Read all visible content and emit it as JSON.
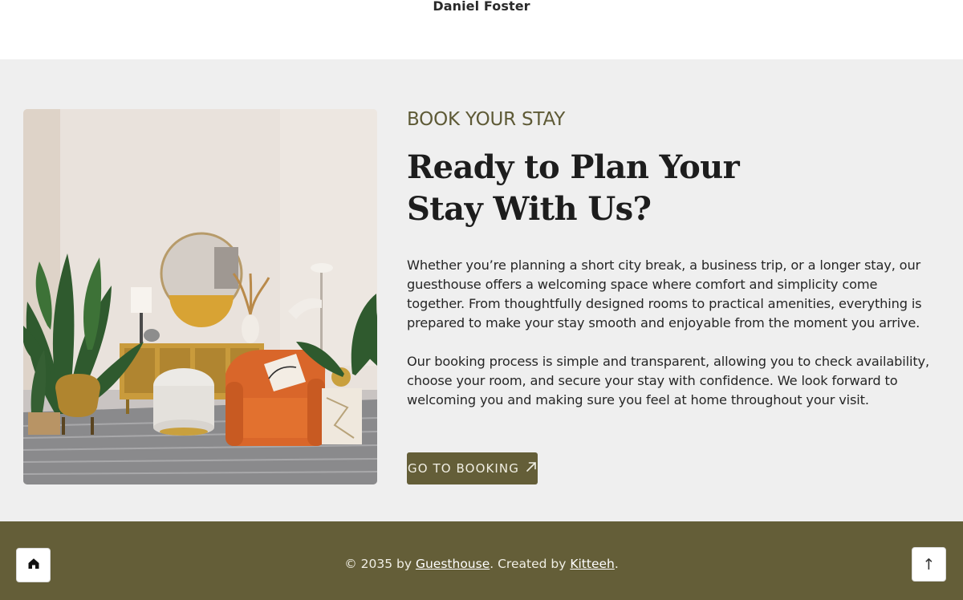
{
  "testimonial": {
    "author": "Daniel Foster"
  },
  "booking": {
    "eyebrow": "BOOK YOUR STAY",
    "heading_line1": "Ready to Plan Your",
    "heading_line2": "Stay With Us?",
    "paragraph1": "Whether you’re planning a short city break, a business trip, or a longer stay, our guesthouse offers a welcoming space where comfort and simplicity come together. From thoughtfully designed rooms to practical amenities, everything is prepared to make your stay smooth and enjoyable from the moment you arrive.",
    "paragraph2": "Our booking process is simple and transparent, allowing you to check availability, choose your room, and secure your stay with confidence. We look forward to welcoming you and making sure you feel at home throughout your visit.",
    "button_label": "GO TO BOOKING",
    "button_icon": "arrow-up-right-icon"
  },
  "footer": {
    "copyright_prefix": "© 2035 by ",
    "brand_link": "Guesthouse",
    "middle_text": ". Created by ",
    "creator_link": "Kitteeh",
    "suffix": ".",
    "home_icon": "home-icon",
    "back_to_top_label": "↑"
  },
  "colors": {
    "accent": "#645e38",
    "section_background": "#efefef",
    "eyebrow": "#5e5a36"
  }
}
